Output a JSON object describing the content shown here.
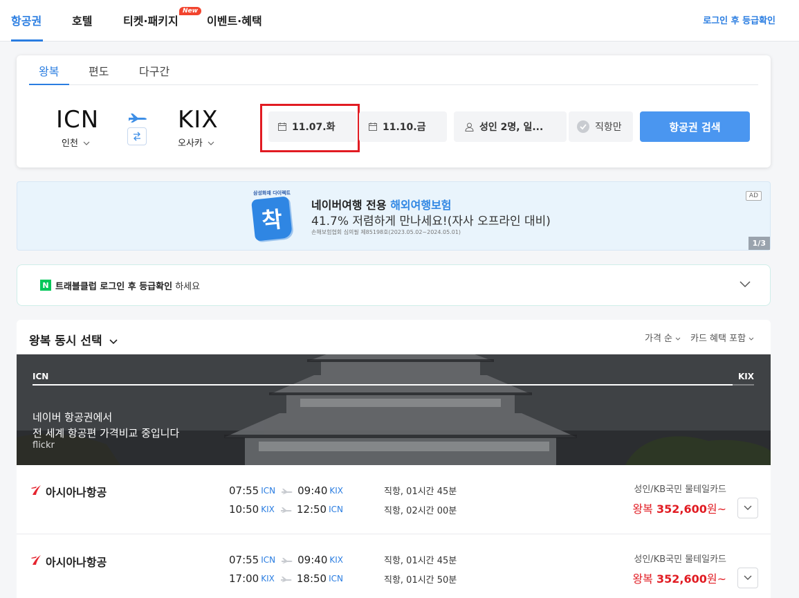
{
  "nav": {
    "items": [
      {
        "label": "항공권",
        "active": true
      },
      {
        "label": "호텔",
        "active": false
      },
      {
        "label": "티켓·패키지",
        "active": false
      },
      {
        "label": "이벤트·혜택",
        "active": false
      }
    ],
    "new_badge": "New",
    "login_link": "로그인 후 등급확인"
  },
  "search": {
    "trip_tabs": [
      "왕복",
      "편도",
      "다구간"
    ],
    "active_trip_tab": "왕복",
    "origin": {
      "code": "ICN",
      "city": "인천"
    },
    "destination": {
      "code": "KIX",
      "city": "오사카"
    },
    "depart_date": "11.07.화",
    "return_date": "11.10.금",
    "passengers": "성인 2명, 일...",
    "direct_only": "직항만",
    "search_button": "항공권 검색"
  },
  "ad": {
    "brand_small": "삼성화재 다이렉트",
    "logo_text": "착",
    "title_prefix": "네이버여행 전용 ",
    "title_highlight": "해외여행보험",
    "subtitle": "41.7% 저렴하게 만나세요!(자사 오프라인 대비)",
    "note": "손해보험협회 심의필 제85198호(2023.05.02~2024.05.01)",
    "tag": "AD",
    "pager": "1/3"
  },
  "club": {
    "badge": "N",
    "text_bold": "트래블클럽 로그인 후 등급확인",
    "text_rest": " 하세요"
  },
  "results": {
    "title": "왕복 동시 선택",
    "sort_price": "가격 순",
    "sort_card": "카드 혜택 포함",
    "hero": {
      "from": "ICN",
      "to": "KIX",
      "progress": 0.97,
      "line1": "네이버 항공권에서",
      "line2": "전 세계 항공편 가격비교 중입니다",
      "credit": "flickr"
    },
    "flights": [
      {
        "airline": "아시아나항공",
        "legs": [
          {
            "dep_time": "07:55",
            "dep_code": "ICN",
            "arr_time": "09:40",
            "arr_code": "KIX",
            "info": "직항, 01시간 45분"
          },
          {
            "dep_time": "10:50",
            "dep_code": "KIX",
            "arr_time": "12:50",
            "arr_code": "ICN",
            "info": "직항, 02시간 00분"
          }
        ],
        "card": "성인/KB국민 물테일카드",
        "price_prefix": "왕복 ",
        "price": "352,600",
        "price_suffix": "원~"
      },
      {
        "airline": "아시아나항공",
        "legs": [
          {
            "dep_time": "07:55",
            "dep_code": "ICN",
            "arr_time": "09:40",
            "arr_code": "KIX",
            "info": "직항, 01시간 45분"
          },
          {
            "dep_time": "17:00",
            "dep_code": "KIX",
            "arr_time": "18:50",
            "arr_code": "ICN",
            "info": "직항, 01시간 50분"
          }
        ],
        "card": "성인/KB국민 물테일카드",
        "price_prefix": "왕복 ",
        "price": "352,600",
        "price_suffix": "원~"
      }
    ]
  },
  "colors": {
    "accent": "#2a7de1",
    "price_red": "#e11b22",
    "search_button": "#4a96f0",
    "asiana_red": "#e5232e"
  }
}
